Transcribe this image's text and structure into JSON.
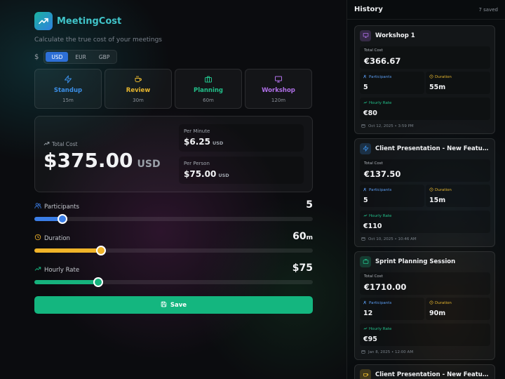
{
  "app": {
    "name": "MeetingCost",
    "tagline": "Calculate the true cost of your meetings",
    "accent": "#40c4c9",
    "logo_icon": "trending-up-icon"
  },
  "currency": {
    "symbol": "$",
    "options": [
      "USD",
      "EUR",
      "GBP"
    ],
    "selected": "USD"
  },
  "presets": [
    {
      "name": "Standup",
      "duration": "15m",
      "icon": "zap-icon",
      "color": "#3b8ee6"
    },
    {
      "name": "Review",
      "duration": "30m",
      "icon": "coffee-icon",
      "color": "#e6b62e"
    },
    {
      "name": "Planning",
      "duration": "60m",
      "icon": "briefcase-icon",
      "color": "#22c08a"
    },
    {
      "name": "Workshop",
      "duration": "120m",
      "icon": "presentation-icon",
      "color": "#b070e8"
    }
  ],
  "cost": {
    "total_label": "Total Cost",
    "total_value": "$375.00",
    "total_unit": "USD",
    "per_minute_label": "Per Minute",
    "per_minute_value": "$6.25",
    "per_minute_unit": "USD",
    "per_person_label": "Per Person",
    "per_person_value": "$75.00",
    "per_person_unit": "USD"
  },
  "sliders": [
    {
      "label": "Participants",
      "value": "5",
      "suffix": "",
      "icon": "users-icon",
      "color": "#3b7ee6",
      "fill_fraction": 0.1
    },
    {
      "label": "Duration",
      "value": "60",
      "suffix": "m",
      "icon": "clock-icon",
      "color": "#f0b429",
      "fill_fraction": 0.24
    },
    {
      "label": "Hourly Rate",
      "value": "$75",
      "suffix": "",
      "icon": "trending-up-icon",
      "color": "#16b27d",
      "fill_fraction": 0.23
    }
  ],
  "save_label": "Save",
  "history": {
    "title": "History",
    "count": "7 saved",
    "cards": [
      {
        "name": "Workshop 1",
        "icon": "presentation-icon",
        "icon_color": "#b070e8",
        "total_label": "Total Cost",
        "total": "€366.67",
        "participants_label": "Participants",
        "participants": "5",
        "duration_label": "Duration",
        "duration": "55m",
        "rate_label": "Hourly Rate",
        "rate": "€80",
        "date": "Oct 12, 2025 • 3:59 PM"
      },
      {
        "name": "Client Presentation - New Features",
        "icon": "zap-icon",
        "icon_color": "#3b8ee6",
        "total_label": "Total Cost",
        "total": "€137.50",
        "participants_label": "Participants",
        "participants": "5",
        "duration_label": "Duration",
        "duration": "15m",
        "rate_label": "Hourly Rate",
        "rate": "€110",
        "date": "Oct 10, 2025 • 10:46 AM"
      },
      {
        "name": "Sprint Planning Session",
        "icon": "briefcase-icon",
        "icon_color": "#22c08a",
        "total_label": "Total Cost",
        "total": "€1710.00",
        "participants_label": "Participants",
        "participants": "12",
        "duration_label": "Duration",
        "duration": "90m",
        "rate_label": "Hourly Rate",
        "rate": "€95",
        "date": "Jan 8, 2025 • 12:00 AM"
      },
      {
        "name": "Client Presentation - New Features",
        "icon": "coffee-icon",
        "icon_color": "#e6b62e"
      }
    ]
  }
}
